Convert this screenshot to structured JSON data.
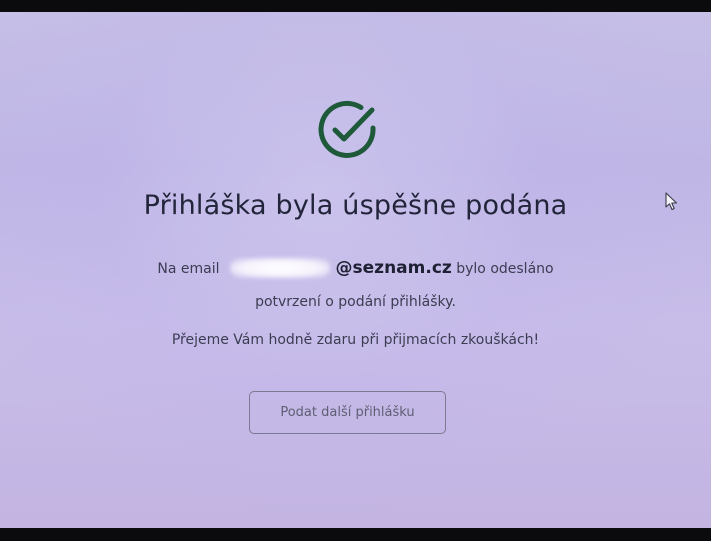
{
  "confirmation": {
    "title": "Přihláška byla úspěšne podána",
    "email_prefix": "Na email",
    "email_domain": "@seznam.cz",
    "email_suffix": "bylo odesláno",
    "confirmation_text": "potvrzení o podání přihlášky.",
    "wish_text": "Přejeme Vám hodně zdaru při přijmacích zkouškách!",
    "button_label": "Podat další přihlášku"
  },
  "colors": {
    "check_icon": "#1e5a3a",
    "title_text": "#22253a",
    "background": "#c3b9e6"
  },
  "icons": {
    "success": "check-circle-icon",
    "pointer": "mouse-cursor-icon"
  }
}
